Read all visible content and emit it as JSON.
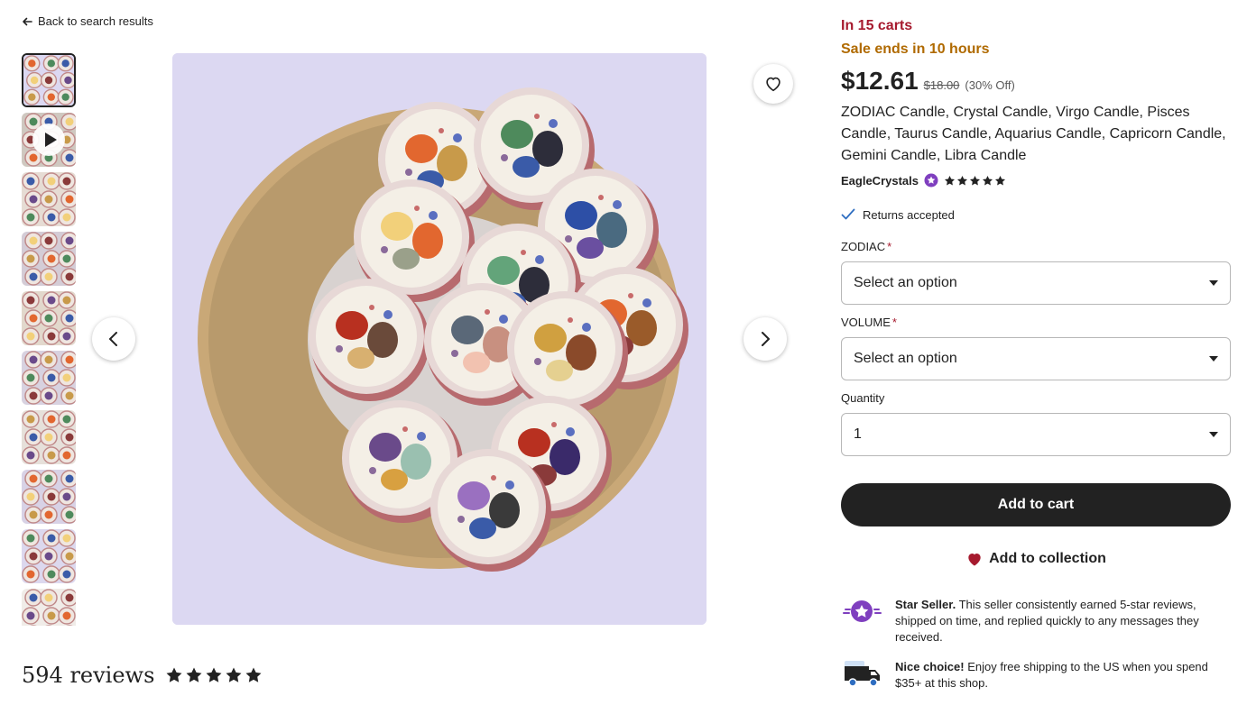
{
  "nav": {
    "back_label": "Back to search results"
  },
  "gallery": {
    "thumbnail_count": 10,
    "active_index": 0,
    "video_thumb_index": 1
  },
  "listing": {
    "in_carts": "In 15 carts",
    "sale_ends": "Sale ends in 10 hours",
    "price": "$12.61",
    "original_price": "$18.00",
    "discount": "(30% Off)",
    "title": "ZODIAC Candle, Crystal Candle, Virgo Candle, Pisces Candle, Taurus Candle, Aquarius Candle, Capricorn Candle, Gemini Candle, Libra Candle",
    "shop_name": "EagleCrystals",
    "shop_rating_stars": 5,
    "returns": "Returns accepted"
  },
  "options": {
    "zodiac_label": "ZODIAC",
    "zodiac_value": "Select an option",
    "volume_label": "VOLUME",
    "volume_value": "Select an option",
    "required_mark": "*",
    "quantity_label": "Quantity",
    "quantity_value": "1"
  },
  "actions": {
    "add_to_cart": "Add to cart",
    "add_to_collection": "Add to collection"
  },
  "perks": {
    "star_seller_title": "Star Seller.",
    "star_seller_text": "This seller consistently earned 5-star reviews, shipped on time, and replied quickly to any messages they received.",
    "shipping_title": "Nice choice!",
    "shipping_text": "Enjoy free shipping to the US when you spend $35+ at this shop."
  },
  "reviews": {
    "count_label": "594 reviews",
    "rating_stars": 5
  },
  "colors": {
    "cart_alert": "#a61a2e",
    "sale_alert": "#b06a00",
    "primary_button": "#222222",
    "star_seller_purple": "#7f3fbf",
    "heart_red": "#a61a2e"
  }
}
